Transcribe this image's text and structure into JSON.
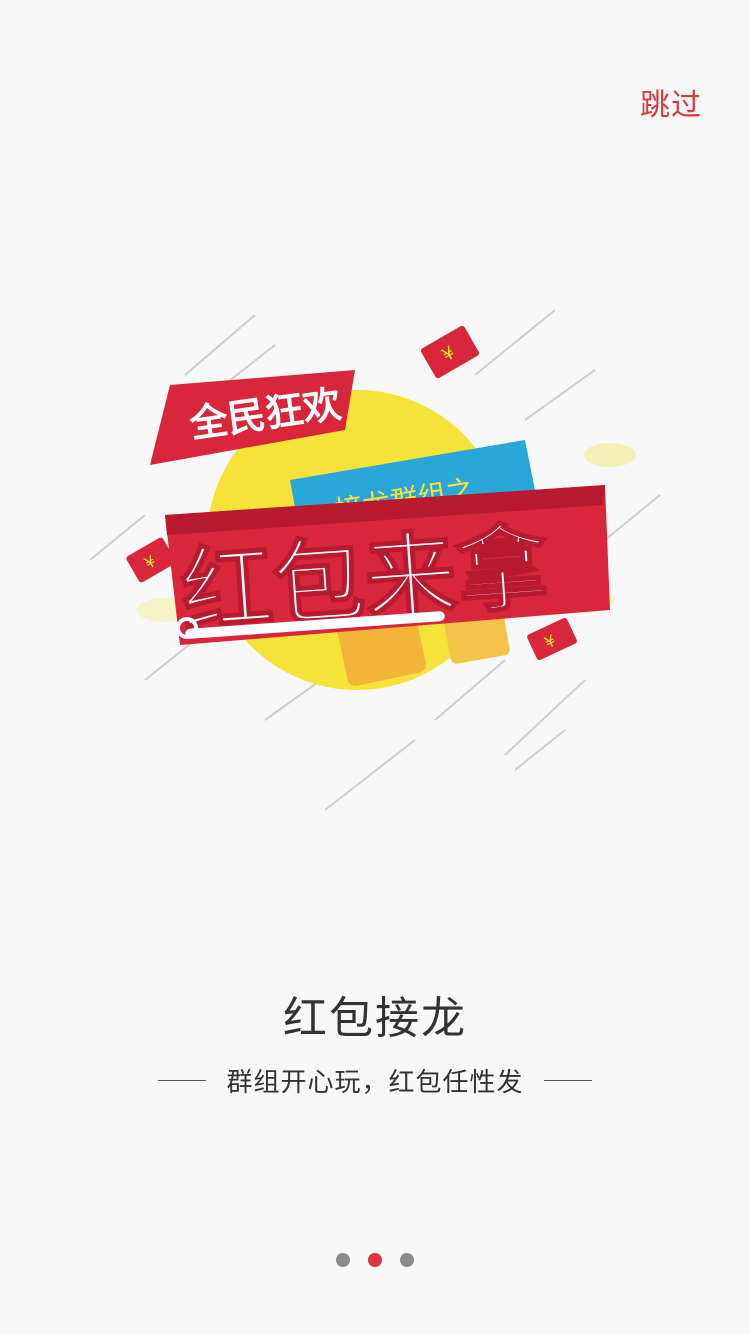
{
  "header": {
    "skip_label": "跳过"
  },
  "hero": {
    "badge_text": "全民狂欢",
    "subtitle_text": "接龙群组之",
    "main_text": "红包来拿",
    "currency_symbol": "¥",
    "badge_color": "#d8263a",
    "sun_color": "#f6e33a",
    "ribbon_color": "#2aa7d8"
  },
  "content": {
    "title": "红包接龙",
    "subtitle": "群组开心玩，红包任性发"
  },
  "pager": {
    "total": 3,
    "active_index": 1
  }
}
